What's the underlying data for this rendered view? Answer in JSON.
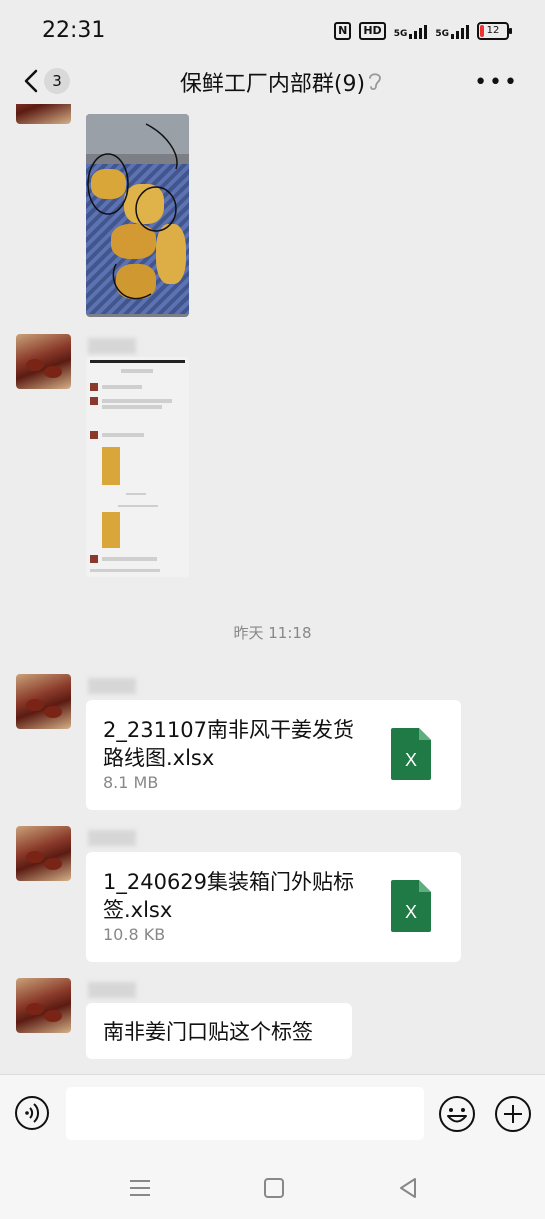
{
  "status": {
    "time": "22:31",
    "battery": "12",
    "net1": "5G",
    "net2": "5G",
    "hd": "HD"
  },
  "header": {
    "back_count": "3",
    "title": "保鲜工厂内部群(9)"
  },
  "chat": {
    "time_separator": "昨天 11:18",
    "messages": [
      {
        "type": "file",
        "name": "2_231107南非风干姜发货路线图.xlsx",
        "size": "8.1 MB",
        "icon": "excel-icon"
      },
      {
        "type": "file",
        "name": "1_240629集装箱门外贴标签.xlsx",
        "size": "10.8 KB",
        "icon": "excel-icon"
      },
      {
        "type": "text",
        "text": "南非姜门口贴这个标签"
      }
    ],
    "file_icon_letter": "X"
  },
  "colors": {
    "excel": "#1f7a45",
    "background": "#ededed",
    "bubble": "#ffffff"
  }
}
